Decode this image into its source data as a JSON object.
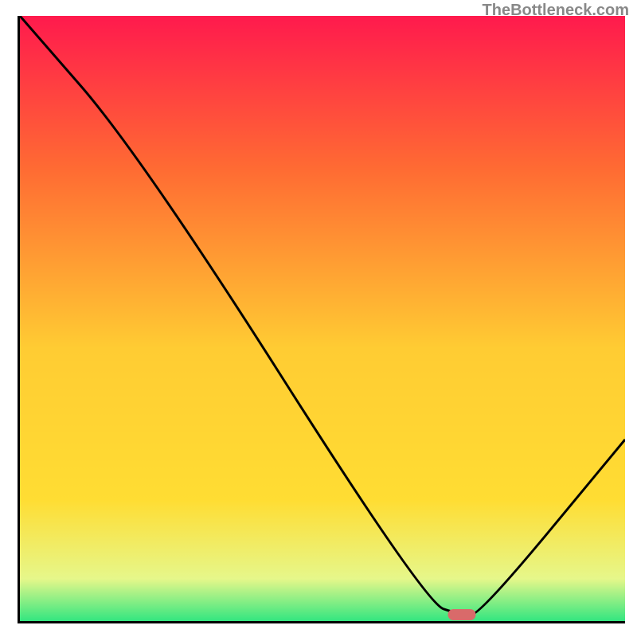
{
  "watermark": "TheBottleneck.com",
  "chart_data": {
    "type": "line",
    "title": "",
    "xlabel": "",
    "ylabel": "",
    "xlim": [
      0,
      100
    ],
    "ylim": [
      0,
      100
    ],
    "gradient_background": {
      "top_color": "#ff1a4d",
      "mid_color": "#ffdd33",
      "bottom_color": "#33e680"
    },
    "series": [
      {
        "name": "curve",
        "x": [
          0,
          20,
          67,
          73,
          76,
          100
        ],
        "y": [
          100,
          77,
          3,
          1,
          1,
          30
        ]
      }
    ],
    "marker": {
      "x": 73,
      "y": 1,
      "color": "#d96a6a"
    }
  }
}
